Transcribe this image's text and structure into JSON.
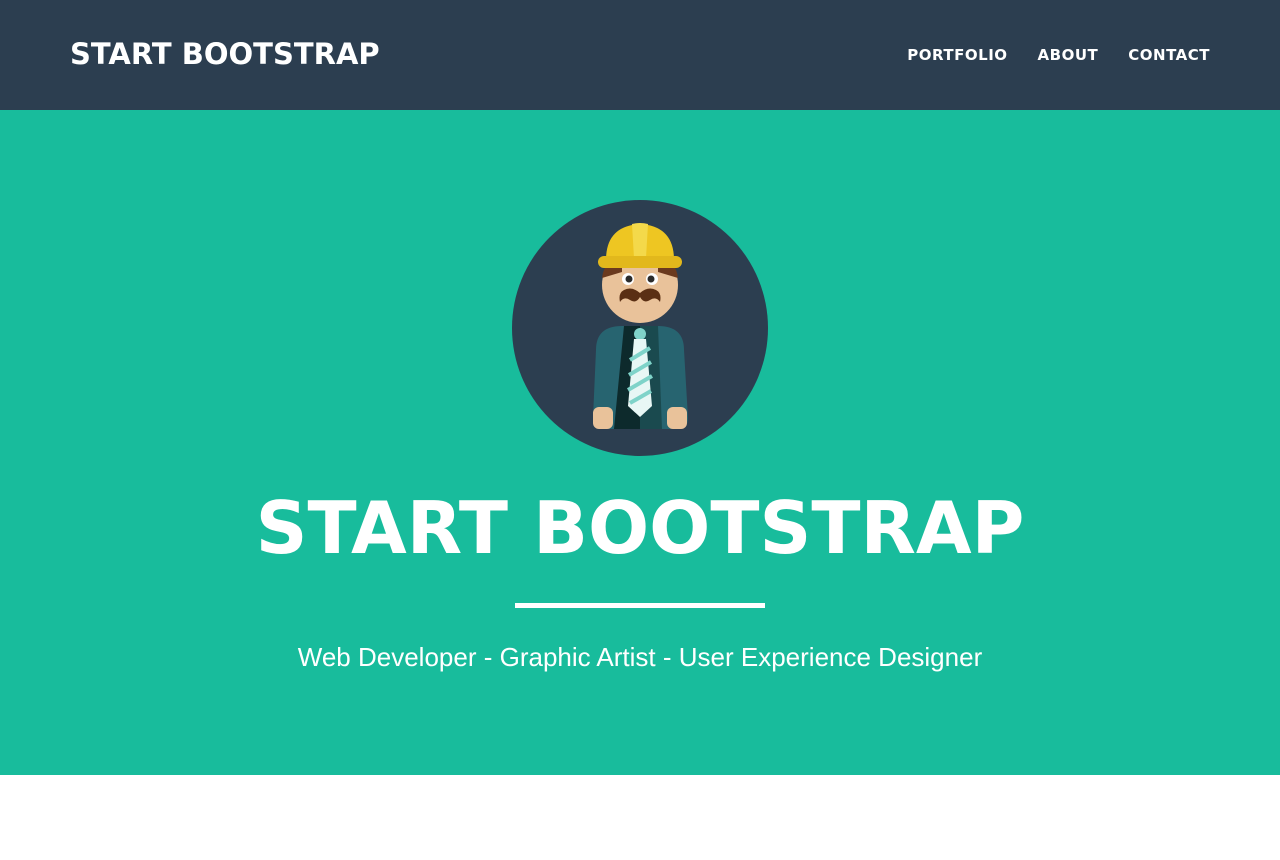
{
  "navbar": {
    "brand": "START BOOTSTRAP",
    "links": [
      "PORTFOLIO",
      "ABOUT",
      "CONTACT"
    ]
  },
  "hero": {
    "avatar_icon": "developer-avatar-icon",
    "title": "START BOOTSTRAP",
    "subtitle": "Web Developer - Graphic Artist - User Experience Designer"
  },
  "colors": {
    "navbar_bg": "#2c3e50",
    "hero_bg": "#18bc9c",
    "text": "#ffffff"
  }
}
